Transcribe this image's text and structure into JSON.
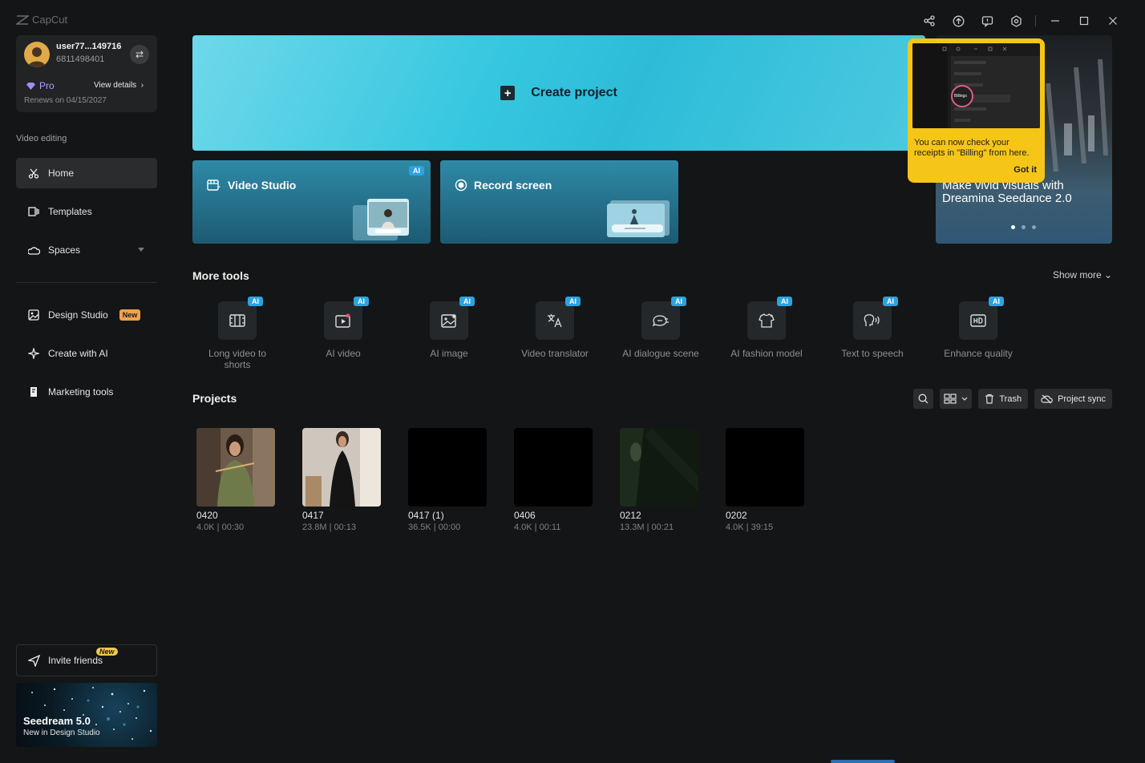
{
  "app": {
    "name": "CapCut"
  },
  "user": {
    "name": "user77...149716",
    "id": "6811498401",
    "plan": "Pro",
    "view_details": "View details",
    "renews": "Renews on 04/15/2027"
  },
  "sidebar": {
    "section_label": "Video editing",
    "items": [
      {
        "label": "Home",
        "icon": "scissors-icon"
      },
      {
        "label": "Templates",
        "icon": "templates-icon"
      },
      {
        "label": "Spaces",
        "icon": "cloud-icon"
      },
      {
        "label": "Design Studio",
        "icon": "design-icon",
        "badge": "New"
      },
      {
        "label": "Create with AI",
        "icon": "sparkle-icon"
      },
      {
        "label": "Marketing tools",
        "icon": "marketing-icon"
      }
    ],
    "invite": {
      "label": "Invite friends",
      "badge": "New"
    },
    "seedream": {
      "title": "Seedream 5.0",
      "subtitle": "New in Design Studio"
    }
  },
  "main": {
    "create_project": "Create project",
    "cards": [
      {
        "label": "Video Studio",
        "badge": "AI"
      },
      {
        "label": "Record screen"
      }
    ],
    "promo": {
      "text_line1": "Make vivid visuals with",
      "text_line2": "Dreamina Seedance 2.0"
    },
    "tooltip": {
      "text": "You can now check your receipts in \"Billing\" from here.",
      "button": "Got it",
      "preview_label": "Billings"
    },
    "more_tools": {
      "title": "More tools",
      "show_more": "Show more",
      "items": [
        {
          "label_line1": "Long video to",
          "label_line2": "shorts",
          "badge": "AI",
          "icon": "film-cut-icon"
        },
        {
          "label_line1": "AI video",
          "label_line2": "",
          "badge": "AI",
          "icon": "video-play-icon"
        },
        {
          "label_line1": "AI image",
          "label_line2": "",
          "badge": "AI",
          "icon": "image-icon"
        },
        {
          "label_line1": "Video translator",
          "label_line2": "",
          "badge": "AI",
          "icon": "translate-icon"
        },
        {
          "label_line1": "AI dialogue scene",
          "label_line2": "",
          "badge": "AI",
          "icon": "dialogue-icon"
        },
        {
          "label_line1": "AI fashion model",
          "label_line2": "",
          "badge": "AI",
          "icon": "shirt-icon"
        },
        {
          "label_line1": "Text to speech",
          "label_line2": "",
          "badge": "AI",
          "icon": "speech-icon"
        },
        {
          "label_line1": "Enhance quality",
          "label_line2": "",
          "badge": "AI",
          "icon": "hd-icon"
        }
      ]
    },
    "projects": {
      "title": "Projects",
      "trash": "Trash",
      "sync": "Project sync",
      "items": [
        {
          "name": "0420",
          "meta": "4.0K | 00:30"
        },
        {
          "name": "0417",
          "meta": "23.8M | 00:13"
        },
        {
          "name": "0417 (1)",
          "meta": "36.5K | 00:00"
        },
        {
          "name": "0406",
          "meta": "4.0K | 00:11"
        },
        {
          "name": "0212",
          "meta": "13.3M | 00:21"
        },
        {
          "name": "0202",
          "meta": "4.0K | 39:15"
        }
      ]
    }
  }
}
